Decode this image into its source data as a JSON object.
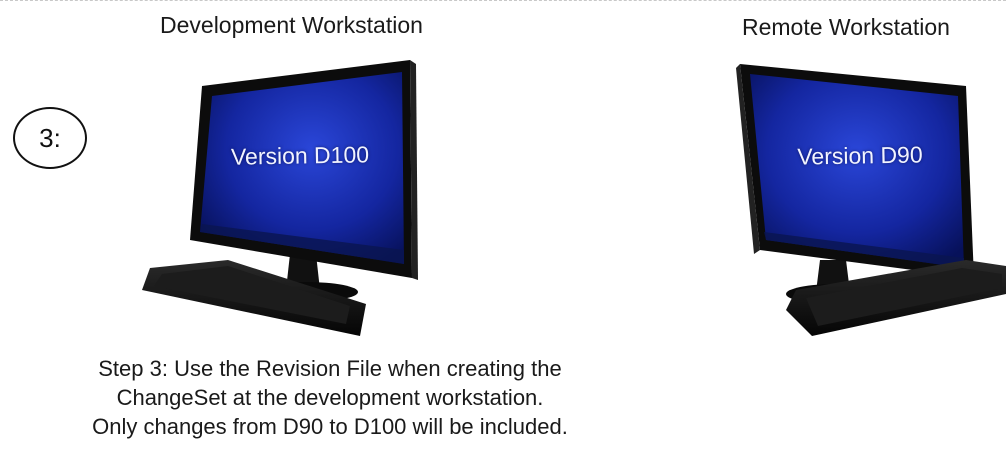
{
  "headings": {
    "left": "Development Workstation",
    "right": "Remote Workstation"
  },
  "step_marker": "3:",
  "screens": {
    "left_version": "Version D100",
    "right_version": "Version D90"
  },
  "caption": {
    "line1": "Step 3: Use the Revision File when creating the",
    "line2": "ChangeSet at the development workstation.",
    "line3": "Only changes from D90 to D100 will be included."
  },
  "colors": {
    "screen_center": "#2a46d8",
    "screen_edge": "#07115a",
    "bezel": "#0c0c0c"
  }
}
